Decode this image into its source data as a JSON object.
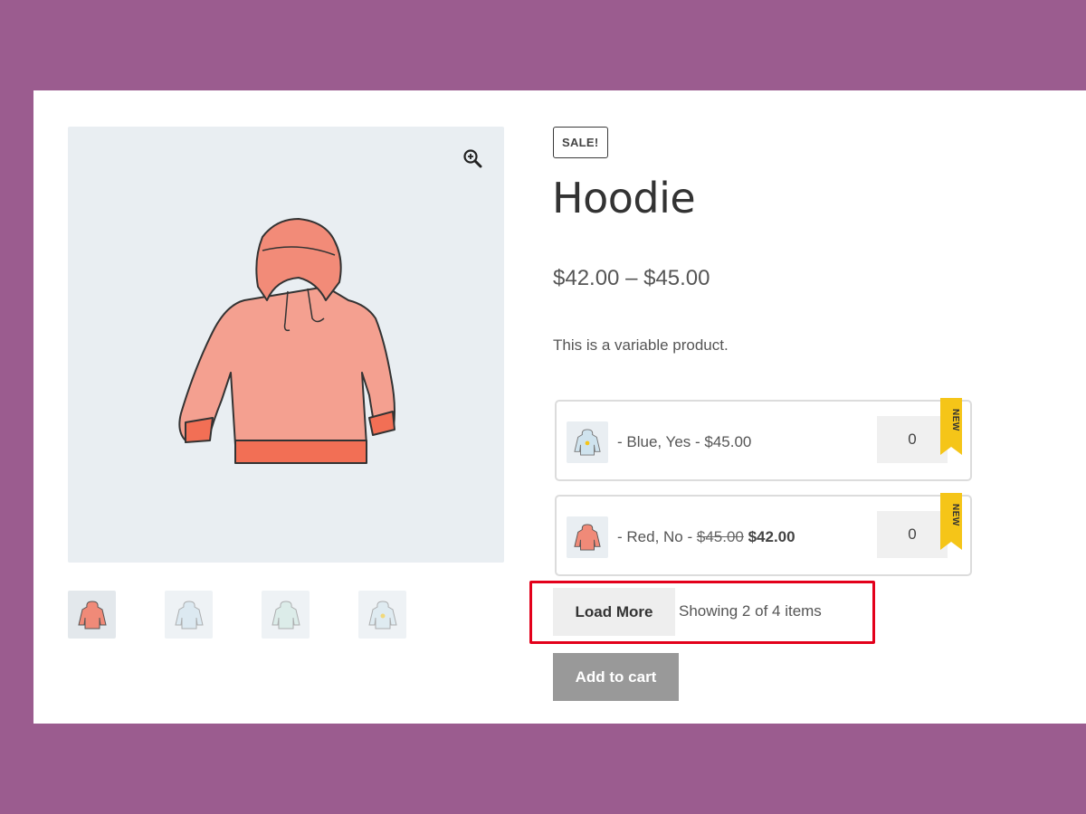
{
  "gallery": {
    "zoom_icon": "zoom-in-icon",
    "thumbnails": [
      {
        "name": "hoodie-red-thumb",
        "color": "#f08a78"
      },
      {
        "name": "hoodie-blue-thumb",
        "color": "#cfe3ee"
      },
      {
        "name": "hoodie-green-thumb",
        "color": "#cfe8e0"
      },
      {
        "name": "hoodie-blue-logo-thumb",
        "color": "#d4e6ef"
      }
    ]
  },
  "product": {
    "badge": "SALE!",
    "title": "Hoodie",
    "price_range": "$42.00 – $45.00",
    "description": "This is a variable product."
  },
  "variations": [
    {
      "label_prefix": "- Blue, Yes - ",
      "price": "$45.00",
      "old_price": "",
      "quantity": "0",
      "ribbon": "NEW",
      "thumb_color": "#cfe3ee"
    },
    {
      "label_prefix": "- Red, No - ",
      "price": "$42.00",
      "old_price": "$45.00",
      "quantity": "0",
      "ribbon": "NEW",
      "thumb_color": "#f08a78"
    }
  ],
  "load_more": {
    "button_label": "Load More",
    "status": "Showing 2 of 4 items"
  },
  "add_to_cart_label": "Add to cart",
  "colors": {
    "page_bg": "#9b5c8f",
    "highlight": "#e3001b",
    "ribbon": "#f5c518",
    "add_to_cart_bg": "#999999"
  }
}
